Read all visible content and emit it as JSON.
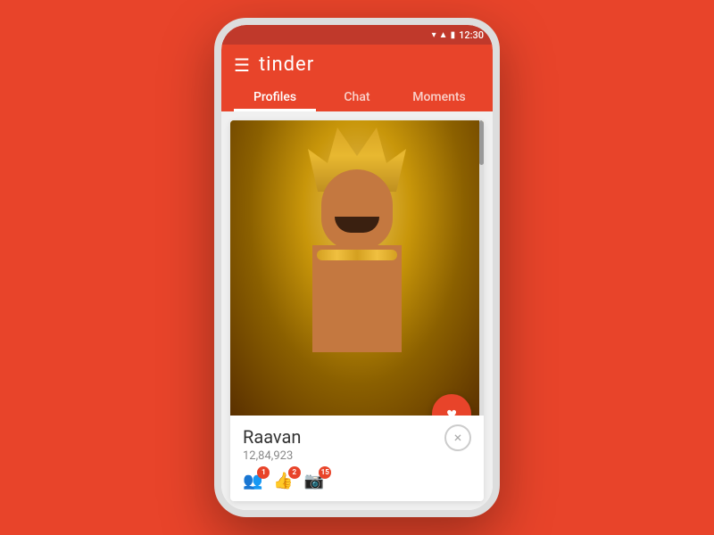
{
  "statusBar": {
    "time": "12:30",
    "icons": [
      "▼",
      "▲",
      "🔋"
    ]
  },
  "topBar": {
    "appName": "tinder",
    "hamburgerLabel": "☰",
    "tabs": [
      {
        "id": "profiles",
        "label": "Profiles",
        "active": true
      },
      {
        "id": "chat",
        "label": "Chat",
        "active": false
      },
      {
        "id": "moments",
        "label": "Moments",
        "active": false
      }
    ]
  },
  "profile": {
    "name": "Raavan",
    "id": "12,84,923",
    "likeButtonLabel": "♥",
    "dismissButtonLabel": "×"
  },
  "social": [
    {
      "id": "friends",
      "icon": "👥",
      "badge": "1"
    },
    {
      "id": "likes",
      "icon": "👍",
      "badge": "2"
    },
    {
      "id": "instagram",
      "icon": "📷",
      "badge": "15"
    }
  ]
}
